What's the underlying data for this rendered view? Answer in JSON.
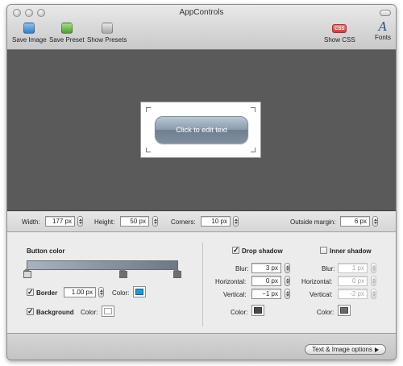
{
  "window": {
    "title": "AppControls"
  },
  "toolbar": {
    "save_image": {
      "label": "Save Image",
      "icon": "save-image-icon",
      "color": "#2e7fc4"
    },
    "save_preset": {
      "label": "Save Preset",
      "icon": "save-preset-icon",
      "color": "#4b9f2d"
    },
    "show_presets": {
      "label": "Show Presets",
      "icon": "show-presets-icon"
    },
    "show_css": {
      "label": "Show CSS",
      "badge": "CSS",
      "icon": "css-icon",
      "color": "#d23a3a"
    },
    "fonts": {
      "label": "Fonts",
      "glyph": "A",
      "icon": "fonts-icon"
    }
  },
  "preview": {
    "button_text": "Click to edit text"
  },
  "size": {
    "width_label": "Width:",
    "width_value": "177 px",
    "height_label": "Height:",
    "height_value": "50 px",
    "corners_label": "Corners:",
    "corners_value": "10 px",
    "margin_label": "Outside margin:",
    "margin_value": "6 px"
  },
  "left_panel": {
    "button_color_label": "Button color",
    "border": {
      "label": "Border",
      "checked": true,
      "width_value": "1.00 px",
      "color_label": "Color:",
      "color": "#1a9bd7"
    },
    "background": {
      "label": "Background",
      "checked": true,
      "color_label": "Color:",
      "color": "#ffffff"
    }
  },
  "drop_shadow": {
    "label": "Drop shadow",
    "checked": true,
    "blur_label": "Blur:",
    "blur_value": "3 px",
    "horizontal_label": "Horizontal:",
    "horizontal_value": "0 px",
    "vertical_label": "Vertical:",
    "vertical_value": "−1 px",
    "color_label": "Color:",
    "color": "#4a4a4a"
  },
  "inner_shadow": {
    "label": "Inner shadow",
    "checked": false,
    "blur_label": "Blur:",
    "blur_value": "1 px",
    "horizontal_label": "Horizontal:",
    "horizontal_value": "0 px",
    "vertical_label": "Vertical:",
    "vertical_value": "-2 px",
    "color_label": "Color:",
    "color": "#6a6a6a"
  },
  "footer": {
    "options_button": "Text & Image options"
  }
}
